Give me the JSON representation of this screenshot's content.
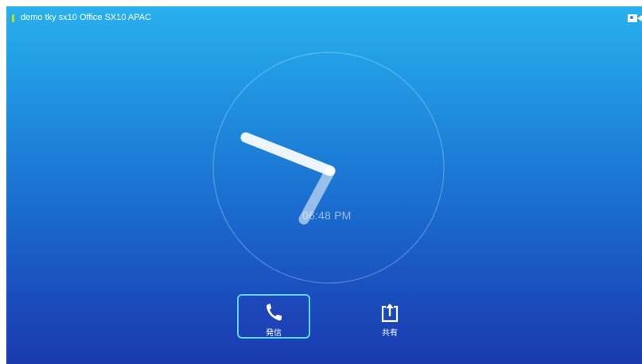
{
  "header": {
    "device_name": "demo tky sx10 Office SX10 APAC",
    "status_color": "#b6e21a",
    "camera_icon": "camera-icon"
  },
  "clock": {
    "time_text": "06:48 PM"
  },
  "actions": {
    "call_label": "発信",
    "call_icon": "phone-icon",
    "share_label": "共有",
    "share_icon": "share-upload-icon"
  },
  "colors": {
    "background_top": "#28b0ee",
    "background_bottom": "#1a3aae",
    "selected_border": "#5fd6ff"
  }
}
